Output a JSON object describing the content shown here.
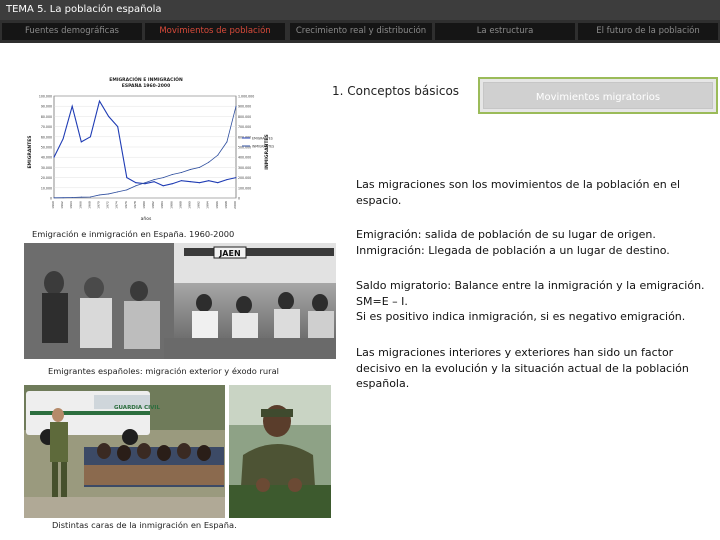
{
  "header": {
    "title": "TEMA 5. La población española"
  },
  "tabs": [
    {
      "label": "Fuentes demográficas",
      "active": false
    },
    {
      "label": "Movimientos de población",
      "active": true
    },
    {
      "label": "Crecimiento real y distribución",
      "active": false
    },
    {
      "label": "La estructura",
      "active": false
    },
    {
      "label": "El futuro de la población",
      "active": false
    }
  ],
  "chart": {
    "title_line1": "EMIGRACIÓN E INMIGRACIÓN",
    "title_line2": "ESPAÑA 1960-2000",
    "left_axis_label": "EMIGRANTES",
    "right_axis_label": "INMIGRANTES",
    "xlabel": "años"
  },
  "chart_data": {
    "type": "line",
    "x": [
      1960,
      1962,
      1964,
      1966,
      1968,
      1970,
      1972,
      1974,
      1976,
      1978,
      1980,
      1982,
      1984,
      1986,
      1988,
      1990,
      1992,
      1994,
      1996,
      1998,
      2000
    ],
    "ylim_left": [
      0,
      100000
    ],
    "ylim_right": [
      0,
      1000000
    ],
    "left_ticks": [
      0,
      10000,
      20000,
      30000,
      40000,
      50000,
      60000,
      70000,
      80000,
      90000,
      100000
    ],
    "right_ticks": [
      0,
      100000,
      200000,
      300000,
      400000,
      500000,
      600000,
      700000,
      800000,
      900000,
      1000000
    ],
    "series": [
      {
        "name": "EMIGRANTES",
        "axis": "left",
        "color": "#1f3cb4",
        "values": [
          40000,
          58000,
          90000,
          55000,
          60000,
          95000,
          80000,
          70000,
          20000,
          15000,
          14000,
          16000,
          12000,
          14000,
          17000,
          16000,
          15000,
          17000,
          15000,
          18000,
          20000
        ]
      },
      {
        "name": "INMIGRANTES",
        "axis": "right",
        "color": "#2f4f9f",
        "values": [
          2000,
          3000,
          5000,
          8000,
          10000,
          30000,
          40000,
          60000,
          80000,
          120000,
          150000,
          180000,
          200000,
          230000,
          250000,
          280000,
          300000,
          350000,
          420000,
          550000,
          900000
        ]
      }
    ]
  },
  "captions": {
    "chart": "Emigración e inmigración en España. 1960-2000",
    "emigrants": "Emigrantes españoles: migración exterior y éxodo rural",
    "immigration": "Distintas caras de la inmigración en España."
  },
  "photos": {
    "station_sign": "JAEN",
    "police_label": "GUARDIA CIVIL"
  },
  "main": {
    "section_title": "1. Conceptos básicos",
    "box_label": "Movimientos migratorios",
    "paragraphs": [
      [
        "Las migraciones son los movimientos de la población en el espacio."
      ],
      [
        "Emigración: salida de población de su lugar de origen.",
        "Inmigración: Llegada de población a un lugar de destino."
      ],
      [
        "Saldo migratorio: Balance entre la inmigración y la emigración.",
        "SM=E – I.",
        "Si es positivo indica inmigración, si es negativo emigración."
      ],
      [
        "Las migraciones interiores y exteriores han sido un factor decisivo en la evolución y la situación actual de la población española."
      ]
    ]
  },
  "colors": {
    "header_bg": "#3d3d3d",
    "nav_bg": "#2f2f2f",
    "tab_bg": "#151515",
    "active_tab": "#d84a3a",
    "box_border": "#9bbb59"
  }
}
